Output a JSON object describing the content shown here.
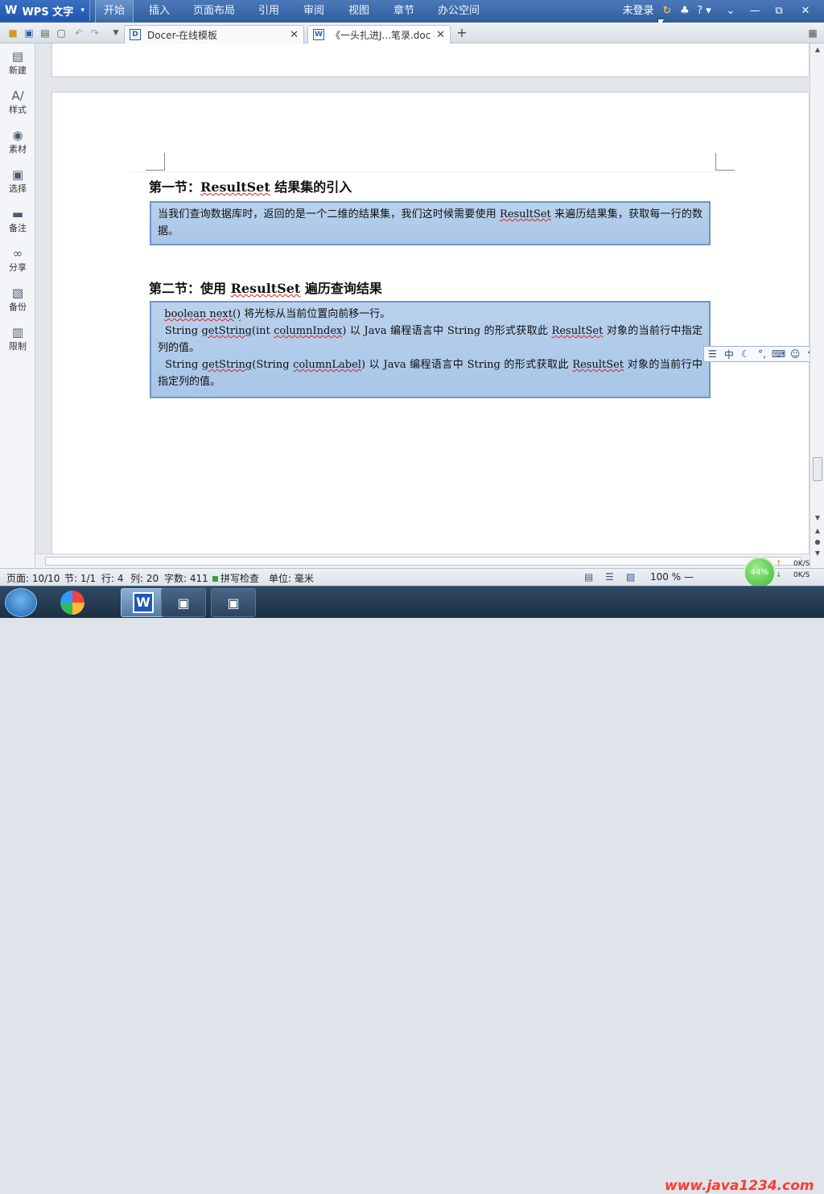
{
  "app": {
    "logo_glyph": "W",
    "app_name": "WPS 文字",
    "dropdown_glyph": "▾"
  },
  "menu": [
    "开始",
    "插入",
    "页面布局",
    "引用",
    "审阅",
    "视图",
    "章节",
    "办公空间"
  ],
  "menu_active_index": 0,
  "account": {
    "login": "未登录"
  },
  "window_controls": {
    "skin": "♣",
    "help": "? ▾",
    "collapse": "⌄",
    "minimize": "—",
    "restore": "⧉",
    "close": "✕"
  },
  "quick_access": [
    "folder-open-icon",
    "save-icon",
    "print-icon",
    "print-preview-icon",
    "undo-icon",
    "redo-icon",
    "customize-dropdown-icon"
  ],
  "tabs": [
    {
      "icon": "D",
      "label": "Docer-在线模板",
      "active": false
    },
    {
      "icon": "W",
      "label": "《一头扎进J...笔录.doc",
      "active": true
    }
  ],
  "new_tab_glyph": "+",
  "sidebar": [
    {
      "icon": "new-doc-icon",
      "glyph": "▤",
      "label": "新建"
    },
    {
      "icon": "style-icon",
      "glyph": "A∕",
      "label": "样式"
    },
    {
      "icon": "material-icon",
      "glyph": "◉",
      "label": "素材"
    },
    {
      "icon": "select-icon",
      "glyph": "▣",
      "label": "选择"
    },
    {
      "icon": "note-icon",
      "glyph": "▬",
      "label": "备注"
    },
    {
      "icon": "share-icon",
      "glyph": "∞",
      "label": "分享"
    },
    {
      "icon": "backup-icon",
      "glyph": "▧",
      "label": "备份"
    },
    {
      "icon": "restrict-icon",
      "glyph": "▥",
      "label": "限制"
    }
  ],
  "document": {
    "section1": {
      "heading_prefix": "第一节：",
      "heading_keyword": "ResultSet",
      "heading_suffix": " 结果集的引入",
      "body_part1": "当我们查询数据库时，返回的是一个二维的结果集，我们这时候需要使用 ",
      "body_keyword": "ResultSet",
      "body_part2": " 来遍历结果集，获取每一行的数据。"
    },
    "section2": {
      "heading_prefix": "第二节：使用 ",
      "heading_keyword": "ResultSet",
      "heading_suffix": " 遍历查询结果",
      "line1_code": "boolean next()",
      "line1_text": " 将光标从当前位置向前移一行。",
      "line2_code_a": "String ",
      "line2_code_b": "getString",
      "line2_code_c": "(int ",
      "line2_code_d": "columnIndex",
      "line2_code_e": ")",
      "line2_text_a": "  以 Java 编程语言中 String 的形式获取此 ",
      "line2_keyword": "ResultSet",
      "line2_text_b": " 对象的当前行中指定列的值。",
      "line3_code_a": "String ",
      "line3_code_b": "getString",
      "line3_code_c": "(String ",
      "line3_code_d": "columnLabel",
      "line3_code_e": ")",
      "line3_text_a": "  以 Java 编程语言中 String 的形式获取此 ",
      "line3_keyword": "ResultSet",
      "line3_text_b": " 对象的当前行中指定列的值。"
    }
  },
  "ime_toolbar": [
    "☰",
    "中",
    "☾",
    "°,",
    "⌨",
    "☺",
    "⚒"
  ],
  "status": {
    "page": "页面: 10/10",
    "section": "节: 1/1",
    "row": "行: 4",
    "col": "列: 20",
    "words": "字数: 411",
    "spellcheck": "拼写检查",
    "unit": "单位: 毫米",
    "zoom": "100 %"
  },
  "network": {
    "percent": "44%",
    "up": "0K/S",
    "down": "0K/S"
  },
  "watermark": "www.java1234.com",
  "colors": {
    "title_bar": "#2f5e9f",
    "box_fill": "#b3cdeb",
    "box_border": "#6f95c4",
    "squiggle": "#e02020"
  }
}
